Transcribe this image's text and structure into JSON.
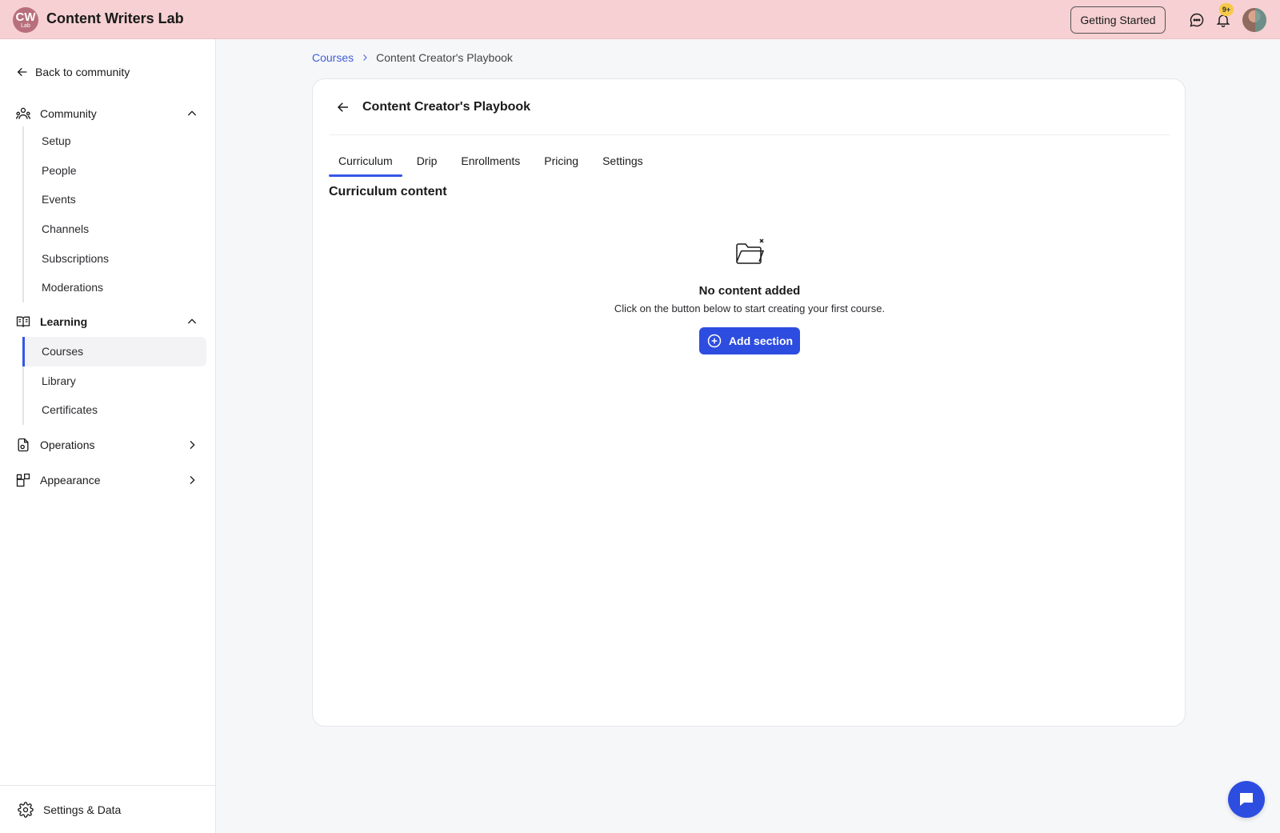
{
  "header": {
    "logo_text": "CW",
    "logo_subtext": "Lab",
    "brand": "Content Writers Lab",
    "getting_started_label": "Getting Started",
    "notification_count": "9+"
  },
  "sidebar": {
    "back_label": "Back to community",
    "community": {
      "label": "Community",
      "items": [
        {
          "label": "Setup"
        },
        {
          "label": "People"
        },
        {
          "label": "Events"
        },
        {
          "label": "Channels"
        },
        {
          "label": "Subscriptions"
        },
        {
          "label": "Moderations"
        }
      ]
    },
    "learning": {
      "label": "Learning",
      "items": [
        {
          "label": "Courses",
          "active": true
        },
        {
          "label": "Library"
        },
        {
          "label": "Certificates"
        }
      ]
    },
    "operations_label": "Operations",
    "appearance_label": "Appearance",
    "footer_label": "Settings & Data"
  },
  "breadcrumb": {
    "link": "Courses",
    "current": "Content Creator's Playbook"
  },
  "course": {
    "title": "Content Creator's Playbook",
    "tabs": [
      {
        "label": "Curriculum",
        "active": true
      },
      {
        "label": "Drip"
      },
      {
        "label": "Enrollments"
      },
      {
        "label": "Pricing"
      },
      {
        "label": "Settings"
      }
    ],
    "section_title": "Curriculum content",
    "empty_title": "No content added",
    "empty_subtitle": "Click on the button below to start creating your first course.",
    "add_button_label": "Add section"
  },
  "colors": {
    "topbar": "#f6d0d2",
    "accent": "#2d4de0",
    "link": "#3f5fd9"
  }
}
